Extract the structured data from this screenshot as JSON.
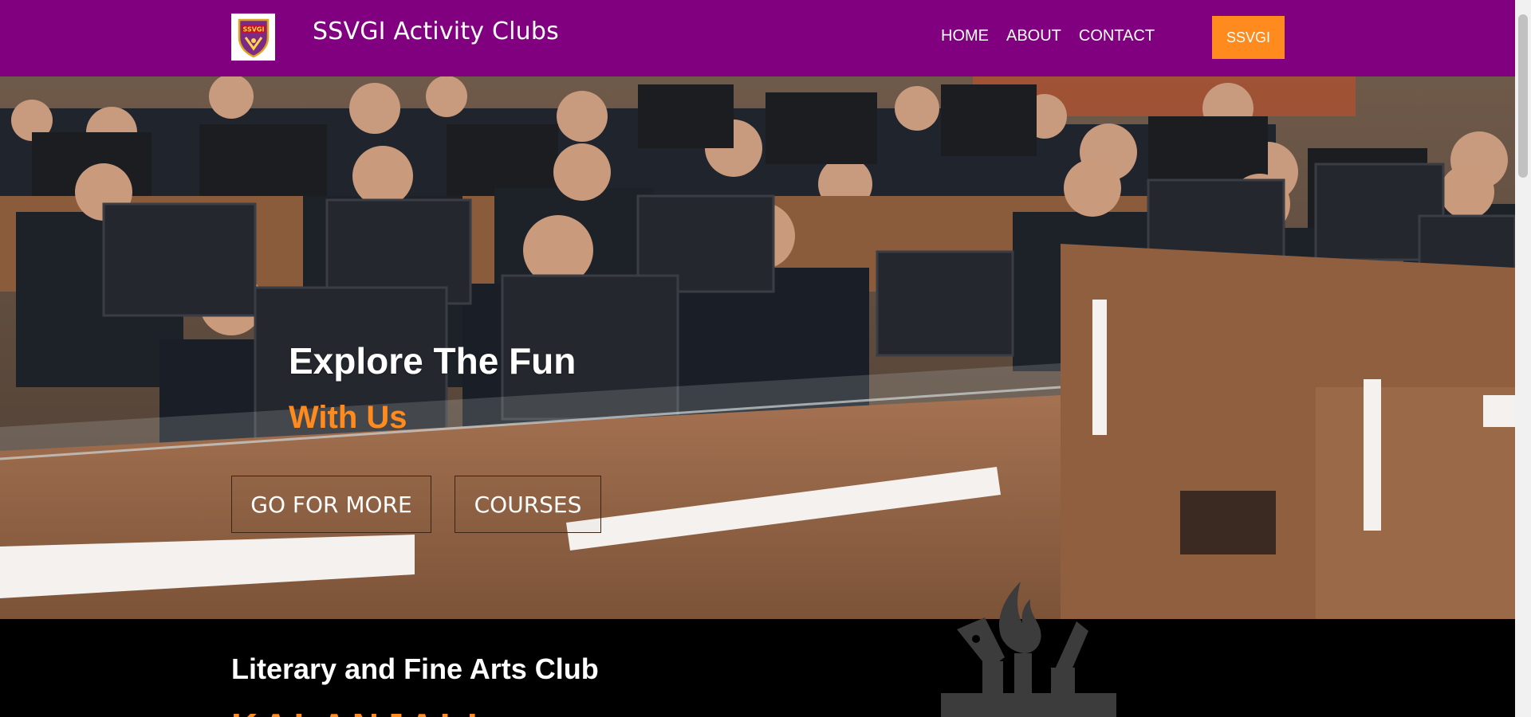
{
  "header": {
    "brand": "SSVGI Activity Clubs",
    "logo_text": "SSVGI",
    "nav": [
      {
        "label": "HOME"
      },
      {
        "label": "ABOUT"
      },
      {
        "label": "CONTACT"
      }
    ],
    "cta_label": "SSVGI",
    "colors": {
      "bar": "#800080",
      "accent": "#ff8a1d"
    }
  },
  "hero": {
    "title": "Explore The Fun",
    "subtitle": "With Us",
    "buttons": [
      {
        "label": "GO FOR MORE"
      },
      {
        "label": "COURSES"
      }
    ],
    "image": "students-computer-lab-photo"
  },
  "section": {
    "title": "Literary and Fine Arts Club",
    "subtitle": "KALANJALI",
    "icon": "pen-and-brush-icon"
  }
}
